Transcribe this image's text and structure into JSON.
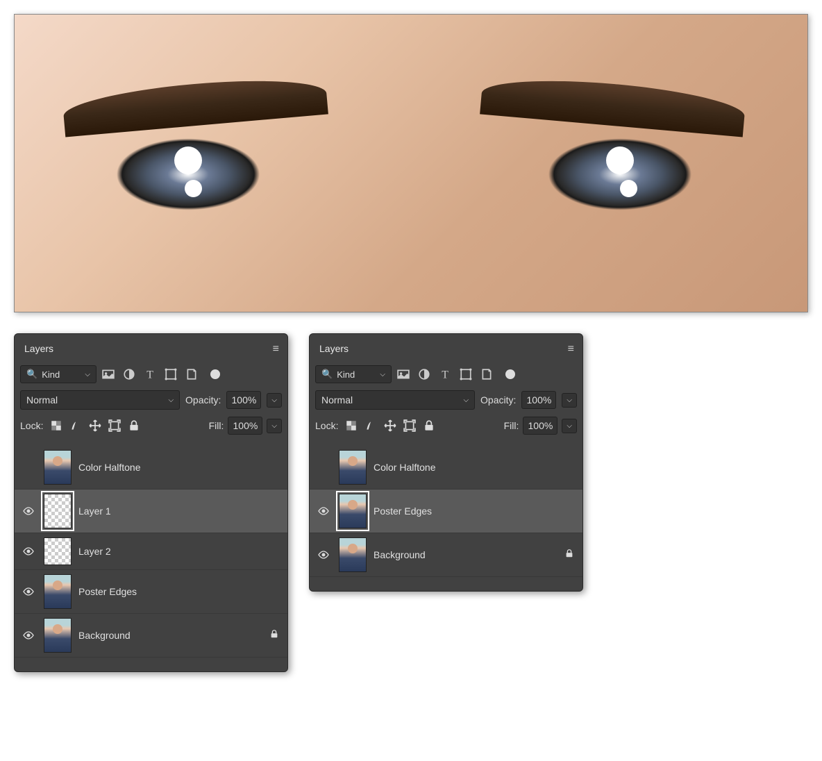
{
  "panel_title": "Layers",
  "filter": {
    "kind_label": "Kind"
  },
  "blend": {
    "mode": "Normal",
    "opacity_label": "Opacity:",
    "opacity_value": "100%"
  },
  "lock": {
    "label": "Lock:",
    "fill_label": "Fill:",
    "fill_value": "100%"
  },
  "panels": {
    "left": {
      "layers": [
        {
          "name": "Color Halftone",
          "visible": false,
          "selected": false,
          "thumb": "photo",
          "locked": false
        },
        {
          "name": "Layer 1",
          "visible": true,
          "selected": true,
          "thumb": "transparent",
          "locked": false
        },
        {
          "name": "Layer 2",
          "visible": true,
          "selected": false,
          "thumb": "transparent",
          "locked": false
        },
        {
          "name": "Poster Edges",
          "visible": true,
          "selected": false,
          "thumb": "photo",
          "locked": false
        },
        {
          "name": "Background",
          "visible": true,
          "selected": false,
          "thumb": "photo",
          "locked": true
        }
      ]
    },
    "right": {
      "layers": [
        {
          "name": "Color Halftone",
          "visible": false,
          "selected": false,
          "thumb": "photo",
          "locked": false
        },
        {
          "name": "Poster Edges",
          "visible": true,
          "selected": true,
          "thumb": "photo",
          "locked": false
        },
        {
          "name": "Background",
          "visible": true,
          "selected": false,
          "thumb": "photo",
          "locked": true
        }
      ]
    }
  }
}
